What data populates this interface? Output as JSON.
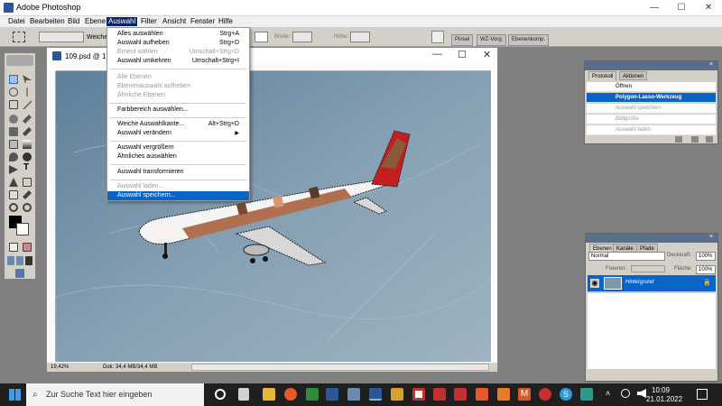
{
  "window": {
    "title": "Adobe Photoshop"
  },
  "menubar": {
    "items": [
      "Datei",
      "Bearbeiten",
      "Bild",
      "Ebene",
      "Auswahl",
      "Filter",
      "Ansicht",
      "Fenster",
      "Hilfe"
    ]
  },
  "options_bar": {
    "weiche_label": "Weiche",
    "breite_label": "Breite:",
    "hoehe_label": "Höhe:",
    "tabs": [
      "Pinsel",
      "WZ-Vorg.",
      "Ebenenkomp."
    ]
  },
  "document": {
    "title": "109.psd @ 19,4",
    "zoom": "19,42%",
    "doc_size": "Dok: 34,4 MB/34,4 MB"
  },
  "auswahl_menu": {
    "items": [
      {
        "label": "Alles auswählen",
        "shortcut": "Strg+A",
        "state": "enabled"
      },
      {
        "label": "Auswahl aufheben",
        "shortcut": "Strg+D",
        "state": "enabled"
      },
      {
        "label": "Erneut wählen",
        "shortcut": "Umschalt+Strg+D",
        "state": "disabled"
      },
      {
        "label": "Auswahl umkehren",
        "shortcut": "Umschalt+Strg+I",
        "state": "enabled"
      },
      {
        "label": "Alle Ebenen",
        "shortcut": "",
        "state": "disabled"
      },
      {
        "label": "Ebenenauswahl aufheben",
        "shortcut": "",
        "state": "disabled"
      },
      {
        "label": "Ähnliche Ebenen",
        "shortcut": "",
        "state": "disabled"
      },
      {
        "label": "Farbbereich auswählen...",
        "shortcut": "",
        "state": "enabled"
      },
      {
        "label": "Weiche Auswahlkante...",
        "shortcut": "Alt+Strg+D",
        "state": "enabled"
      },
      {
        "label": "Auswahl verändern",
        "shortcut": "",
        "state": "enabled",
        "submenu": true
      },
      {
        "label": "Auswahl vergrößern",
        "shortcut": "",
        "state": "enabled"
      },
      {
        "label": "Ähnliches auswählen",
        "shortcut": "",
        "state": "enabled"
      },
      {
        "label": "Auswahl transformieren",
        "shortcut": "",
        "state": "enabled"
      },
      {
        "label": "Auswahl laden...",
        "shortcut": "",
        "state": "disabled"
      },
      {
        "label": "Auswahl speichern...",
        "shortcut": "",
        "state": "highlighted"
      }
    ]
  },
  "history_panel": {
    "tabs": [
      "Protokoll",
      "Aktionen"
    ],
    "items": [
      {
        "label": "Öffnen",
        "state": "normal"
      },
      {
        "label": "Polygon-Lasso-Werkzeug",
        "state": "selected"
      },
      {
        "label": "Auswahl speichern",
        "state": "dim"
      },
      {
        "label": "Bildgröße",
        "state": "dim"
      },
      {
        "label": "Auswahl laden",
        "state": "dim"
      }
    ]
  },
  "layers_panel": {
    "tabs": [
      "Ebenen",
      "Kanäle",
      "Pfade"
    ],
    "blend_mode": "Normal",
    "opacity_label": "Deckkraft:",
    "opacity_value": "100%",
    "lock_label": "Fixieren:",
    "fill_label": "Fläche:",
    "fill_value": "100%",
    "layer_name": "Hintergrund"
  },
  "taskbar": {
    "search_placeholder": "Zur Suche Text hier eingeben",
    "time": "10:09",
    "date": "21.01.2022"
  },
  "colors": {
    "highlight": "#0a64c8",
    "menu_active": "#0a246a",
    "taskbar": "#1f1f1f",
    "canvas_ice": "#7d97a9"
  }
}
